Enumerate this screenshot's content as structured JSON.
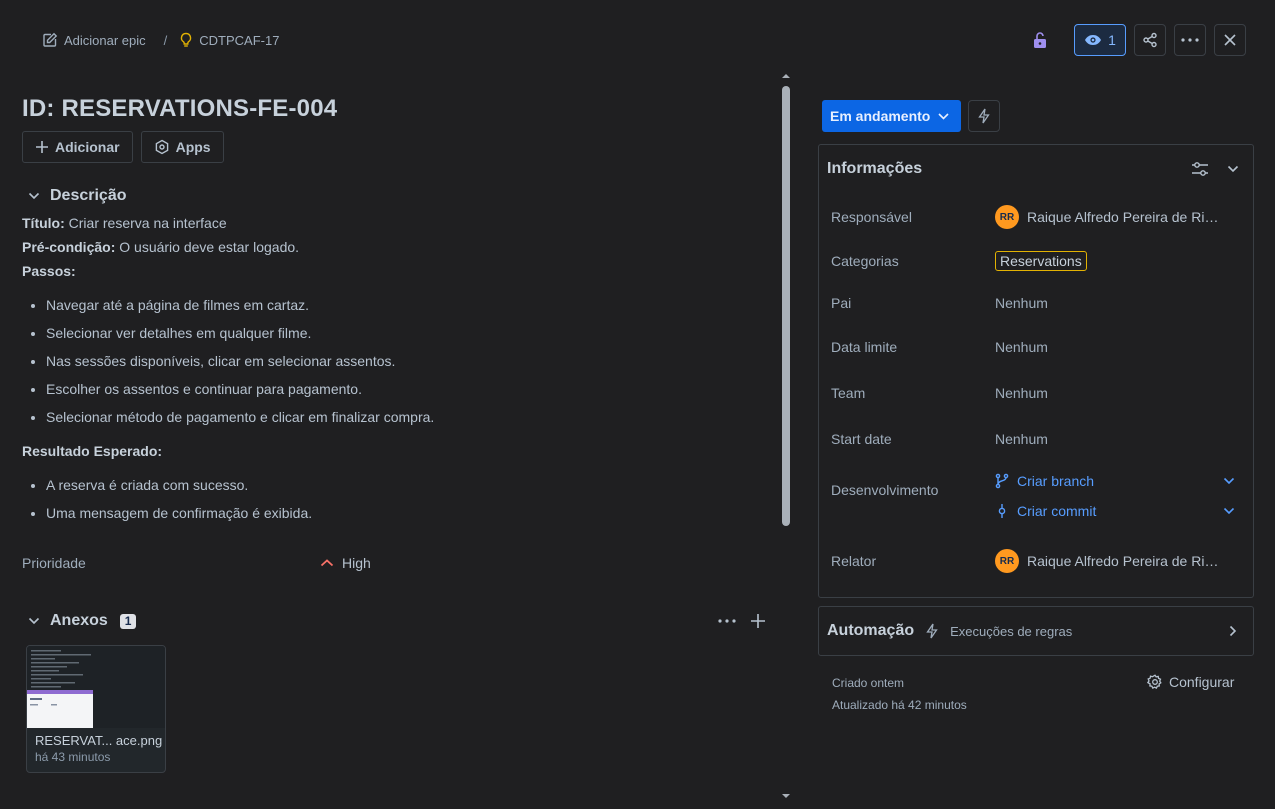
{
  "breadcrumb": {
    "add_epic": "Adicionar epic",
    "separator": "/",
    "issue_key": "CDTPCAF-17"
  },
  "toolbar": {
    "watch_count": "1"
  },
  "issue": {
    "title": "ID: RESERVATIONS-FE-004",
    "add_label": "Adicionar",
    "apps_label": "Apps"
  },
  "description": {
    "heading": "Descrição",
    "title_label": "Título:",
    "title_value": "Criar reserva na interface",
    "precondition_label": "Pré-condição:",
    "precondition_value": "O usuário deve estar logado.",
    "steps_label": "Passos:",
    "steps": [
      "Navegar até a página de filmes em cartaz.",
      "Selecionar ver detalhes em qualquer filme.",
      "Nas sessões disponíveis, clicar em selecionar assentos.",
      "Escolher os assentos e continuar para pagamento.",
      "Selecionar método de pagamento e clicar em finalizar compra."
    ],
    "expected_label": "Resultado Esperado:",
    "expected": [
      "A reserva é criada com sucesso.",
      "Uma mensagem de confirmação é exibida."
    ]
  },
  "priority": {
    "label": "Prioridade",
    "value": "High",
    "color": "#f87168"
  },
  "attachments": {
    "heading": "Anexos",
    "count": "1",
    "file_name": "RESERVAT... ace.png",
    "file_time": "há 43 minutos"
  },
  "status": {
    "label": "Em andamento",
    "color": "#0c66e4"
  },
  "details": {
    "heading": "Informações",
    "assignee_label": "Responsável",
    "assignee_initials": "RR",
    "assignee_name": "Raique Alfredo Pereira de Ribeiro",
    "categories_label": "Categorias",
    "category_value": "Reservations",
    "parent_label": "Pai",
    "parent_value": "Nenhum",
    "due_label": "Data limite",
    "due_value": "Nenhum",
    "team_label": "Team",
    "team_value": "Nenhum",
    "start_label": "Start date",
    "start_value": "Nenhum",
    "dev_label": "Desenvolvimento",
    "create_branch": "Criar branch",
    "create_commit": "Criar commit",
    "reporter_label": "Relator",
    "reporter_initials": "RR",
    "reporter_name": "Raique Alfredo Pereira de Ribeiro"
  },
  "automation": {
    "heading": "Automação",
    "rule_runs": "Execuções de regras"
  },
  "footer": {
    "created": "Criado ontem",
    "updated": "Atualizado há 42 minutos",
    "configure": "Configurar"
  }
}
